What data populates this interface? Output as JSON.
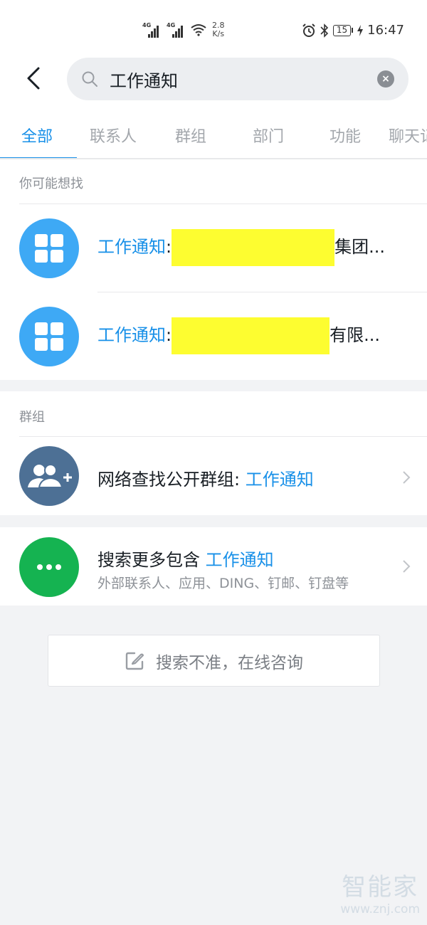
{
  "status_bar": {
    "network1": "4G",
    "network2": "4G",
    "speed_value": "2.8",
    "speed_unit": "K/s",
    "battery": "15",
    "time": "16:47",
    "icons": [
      "signal-icon",
      "signal-icon",
      "wifi-icon",
      "alarm-icon",
      "bluetooth-icon",
      "battery-icon",
      "charging-icon"
    ]
  },
  "search": {
    "value": "工作通知",
    "placeholder": "",
    "clear_icon": "×"
  },
  "tabs": [
    {
      "label": "全部",
      "active": true
    },
    {
      "label": "联系人",
      "active": false
    },
    {
      "label": "群组",
      "active": false
    },
    {
      "label": "部门",
      "active": false
    },
    {
      "label": "功能",
      "active": false
    },
    {
      "label": "聊天记录",
      "active": false
    }
  ],
  "suggest_section": {
    "title": "你可能想找",
    "items": [
      {
        "prefix": "工作通知",
        "colon": ":",
        "suffix": "集团...",
        "redacted": true,
        "icon": "app-grid-icon"
      },
      {
        "prefix": "工作通知",
        "colon": ":",
        "suffix": "有限...",
        "redacted": true,
        "icon": "app-grid-icon"
      }
    ]
  },
  "group_section": {
    "title": "群组",
    "item": {
      "label": "网络查找公开群组: ",
      "keyword": "工作通知",
      "icon": "add-group-icon"
    }
  },
  "more_section": {
    "label": "搜索更多包含 ",
    "keyword": "工作通知",
    "subtitle": "外部联系人、应用、DING、钉邮、钉盘等",
    "icon": "more-icon"
  },
  "consult_button": {
    "label": "搜索不准，在线咨询",
    "icon": "edit-icon"
  },
  "watermark": {
    "name": "智能家",
    "url": "www.znj.com"
  },
  "colors": {
    "accent": "#1890e8",
    "app_icon": "#3ea9f5",
    "group_icon": "#4d7095",
    "more_icon": "#15b351",
    "redaction": "#fdfd30"
  }
}
